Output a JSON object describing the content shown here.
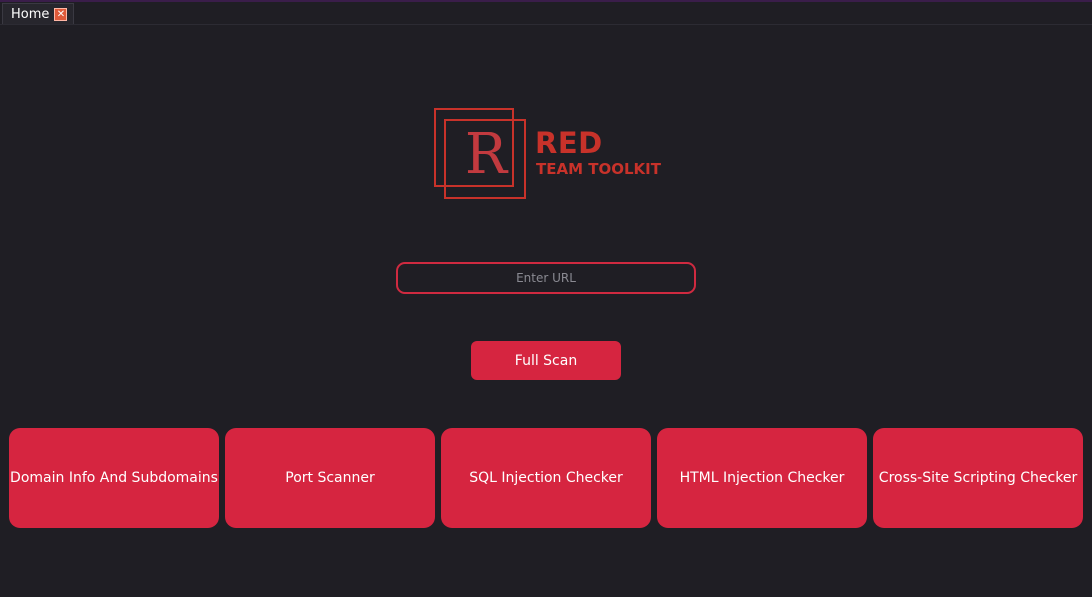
{
  "tab": {
    "label": "Home",
    "close_icon": "close-icon"
  },
  "logo": {
    "letter": "R",
    "word1": "RED",
    "word2": "TEAM TOOLKIT"
  },
  "search": {
    "placeholder": "Enter URL",
    "value": ""
  },
  "actions": {
    "full_scan_label": "Full Scan"
  },
  "tools": [
    {
      "label": "Domain Info And Subdomains"
    },
    {
      "label": "Port Scanner"
    },
    {
      "label": "SQL Injection Checker"
    },
    {
      "label": "HTML Injection Checker"
    },
    {
      "label": "Cross-Site Scripting Checker"
    }
  ],
  "colors": {
    "background": "#1f1e24",
    "accent": "#d62540",
    "logo": "#c8322a",
    "tab_close": "#e05a3a"
  }
}
